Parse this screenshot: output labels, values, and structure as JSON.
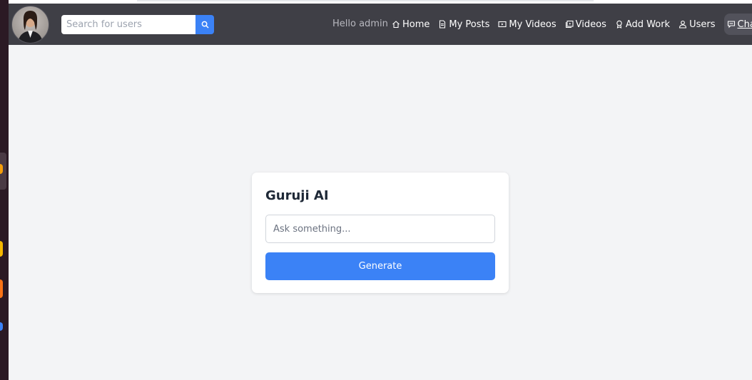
{
  "navbar": {
    "search": {
      "placeholder": "Search for users"
    },
    "greeting": "Hello admin",
    "links": {
      "home": "Home",
      "my_posts": "My Posts",
      "my_videos": "My Videos",
      "videos": "Videos",
      "add_work": "Add Work",
      "users": "Users",
      "chat": "Chat"
    }
  },
  "card": {
    "title": "Guruji AI",
    "input_placeholder": "Ask something...",
    "button_label": "Generate"
  },
  "colors": {
    "navbar_bg": "#3f3f46",
    "accent": "#3b82f6",
    "page_bg": "#f3f4f6"
  }
}
